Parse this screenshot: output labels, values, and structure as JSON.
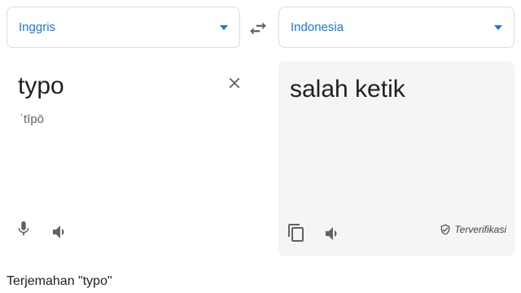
{
  "source": {
    "language": "Inggris",
    "text": "typo",
    "transliteration": "ˈtīpō"
  },
  "target": {
    "language": "Indonesia",
    "text": "salah ketik",
    "verified_label": "Terverifikasi"
  },
  "caption": "Terjemahan \"typo\"",
  "icons": {
    "swap": "swap-languages-icon",
    "clear": "close-icon",
    "mic": "microphone-icon",
    "speaker": "speaker-icon",
    "copy": "copy-icon",
    "verified": "shield-check-icon"
  },
  "colors": {
    "accent": "#1a73e8",
    "panel_bg": "#f5f5f5",
    "icon": "#5f6368"
  }
}
